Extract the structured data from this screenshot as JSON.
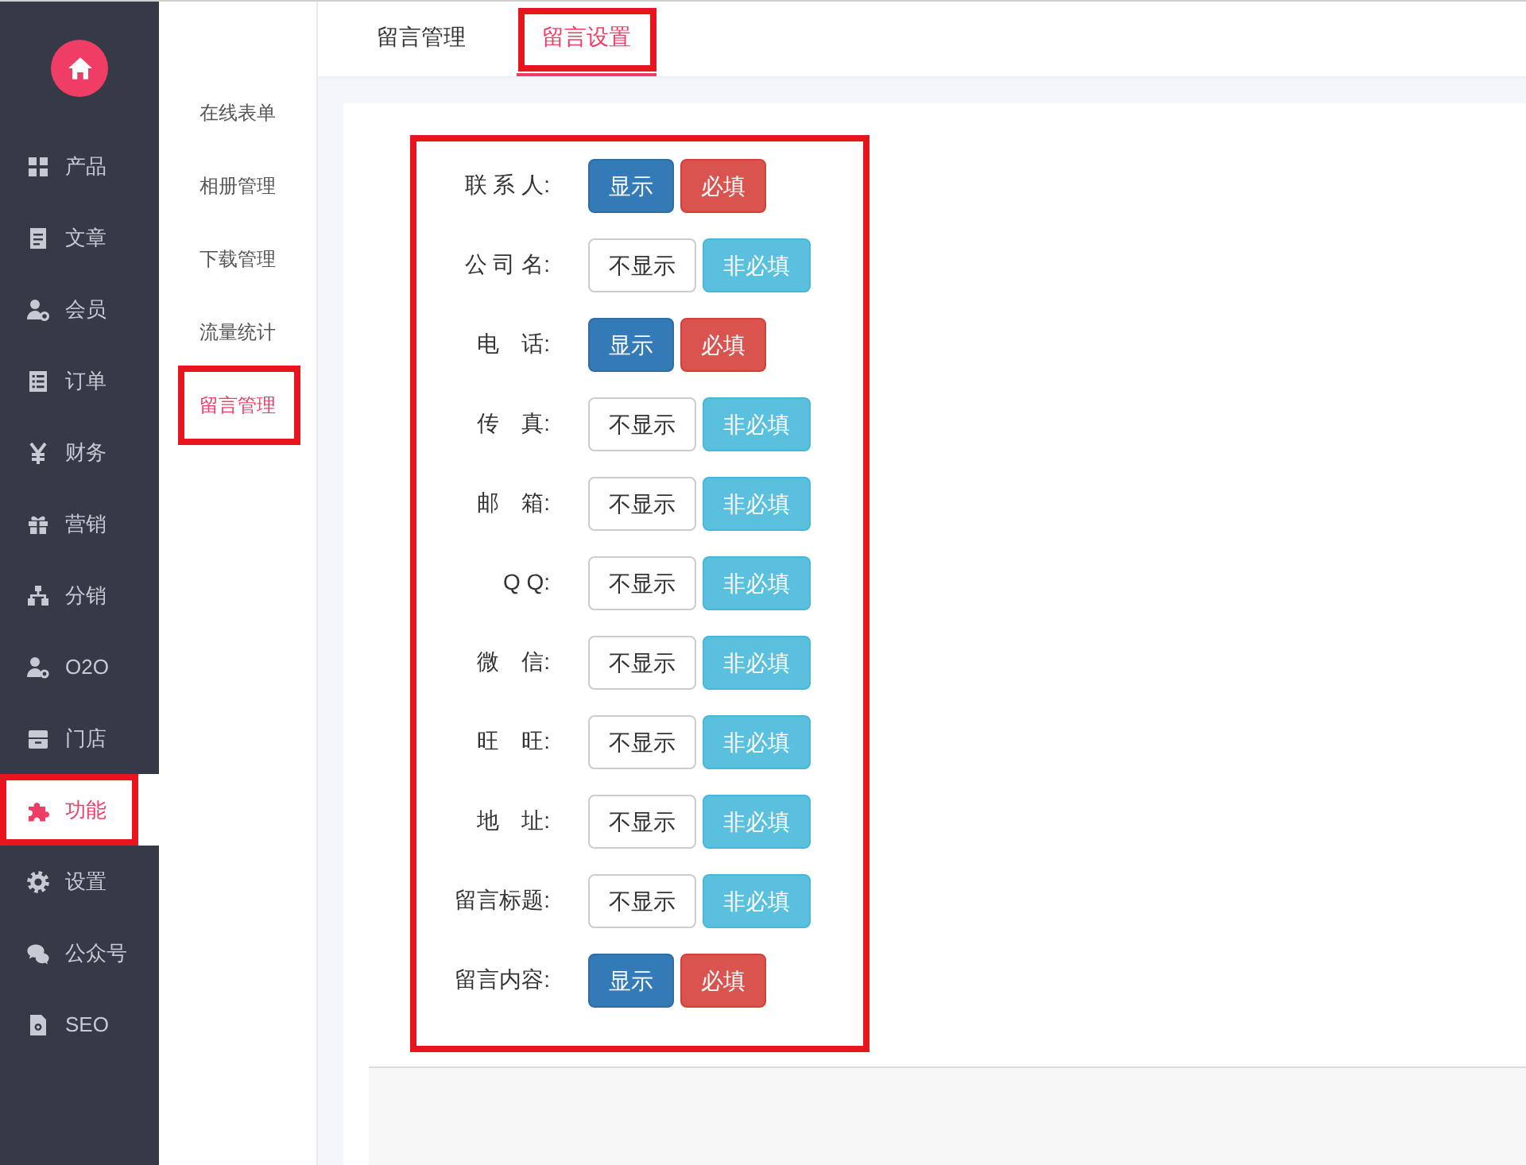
{
  "sidebar": {
    "items": [
      {
        "label": "产品",
        "selected": false,
        "highlighted": false
      },
      {
        "label": "文章",
        "selected": false,
        "highlighted": false
      },
      {
        "label": "会员",
        "selected": false,
        "highlighted": false
      },
      {
        "label": "订单",
        "selected": false,
        "highlighted": false
      },
      {
        "label": "财务",
        "selected": false,
        "highlighted": false
      },
      {
        "label": "营销",
        "selected": false,
        "highlighted": false
      },
      {
        "label": "分销",
        "selected": false,
        "highlighted": false
      },
      {
        "label": "O2O",
        "selected": false,
        "highlighted": false
      },
      {
        "label": "门店",
        "selected": false,
        "highlighted": false
      },
      {
        "label": "功能",
        "selected": true,
        "highlighted": true
      },
      {
        "label": "设置",
        "selected": false,
        "highlighted": false
      },
      {
        "label": "公众号",
        "selected": false,
        "highlighted": false
      },
      {
        "label": "SEO",
        "selected": false,
        "highlighted": false
      }
    ]
  },
  "sub_nav": {
    "items": [
      {
        "label": "在线表单",
        "selected": false,
        "highlighted": false
      },
      {
        "label": "相册管理",
        "selected": false,
        "highlighted": false
      },
      {
        "label": "下载管理",
        "selected": false,
        "highlighted": false
      },
      {
        "label": "流量统计",
        "selected": false,
        "highlighted": false
      },
      {
        "label": "留言管理",
        "selected": true,
        "highlighted": true
      }
    ]
  },
  "tabs": [
    {
      "label": "留言管理",
      "selected": false,
      "highlighted": false
    },
    {
      "label": "留言设置",
      "selected": true,
      "highlighted": true
    }
  ],
  "form": {
    "highlighted": true,
    "fields": [
      {
        "label": "联 系 人:",
        "display": {
          "text": "显示",
          "on": true
        },
        "required": {
          "text": "必填",
          "on": true
        }
      },
      {
        "label": "公 司 名:",
        "display": {
          "text": "不显示",
          "on": false
        },
        "required": {
          "text": "非必填",
          "on": false
        }
      },
      {
        "label": "电　话:",
        "display": {
          "text": "显示",
          "on": true
        },
        "required": {
          "text": "必填",
          "on": true
        }
      },
      {
        "label": "传　真:",
        "display": {
          "text": "不显示",
          "on": false
        },
        "required": {
          "text": "非必填",
          "on": false
        }
      },
      {
        "label": "邮　箱:",
        "display": {
          "text": "不显示",
          "on": false
        },
        "required": {
          "text": "非必填",
          "on": false
        }
      },
      {
        "label": "Q Q:",
        "display": {
          "text": "不显示",
          "on": false
        },
        "required": {
          "text": "非必填",
          "on": false
        }
      },
      {
        "label": "微　信:",
        "display": {
          "text": "不显示",
          "on": false
        },
        "required": {
          "text": "非必填",
          "on": false
        }
      },
      {
        "label": "旺　旺:",
        "display": {
          "text": "不显示",
          "on": false
        },
        "required": {
          "text": "非必填",
          "on": false
        }
      },
      {
        "label": "地　址:",
        "display": {
          "text": "不显示",
          "on": false
        },
        "required": {
          "text": "非必填",
          "on": false
        }
      },
      {
        "label": "留言标题:",
        "display": {
          "text": "不显示",
          "on": false
        },
        "required": {
          "text": "非必填",
          "on": false
        }
      },
      {
        "label": "留言内容:",
        "display": {
          "text": "显示",
          "on": true
        },
        "required": {
          "text": "必填",
          "on": true
        }
      }
    ]
  }
}
